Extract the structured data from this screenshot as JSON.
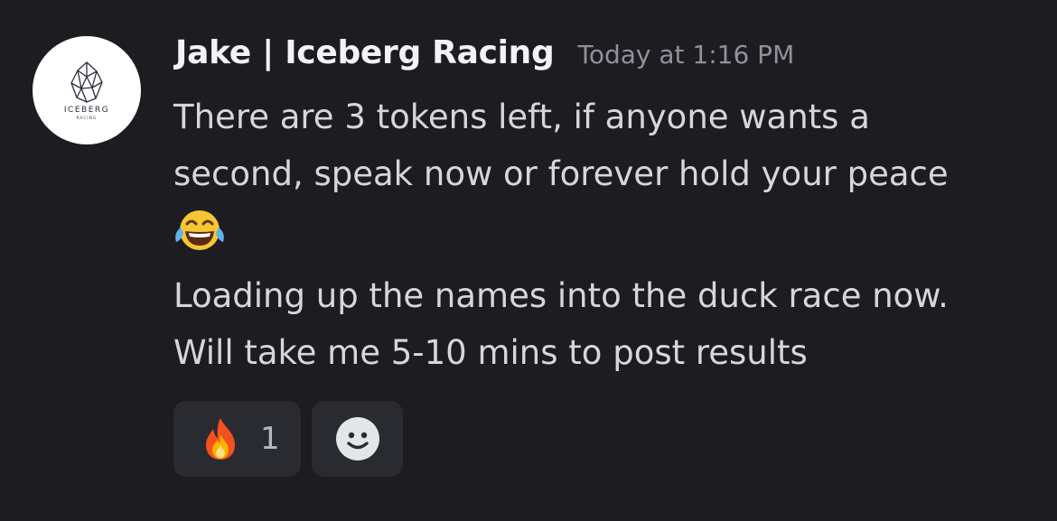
{
  "message": {
    "avatar": {
      "icon": "iceberg-logo-icon",
      "logo_text": "ICEBERG",
      "logo_subtext": "RACING"
    },
    "author": "Jake | Iceberg Racing",
    "timestamp": "Today at 1:16 PM",
    "paragraph1": "There are 3 tokens left, if anyone wants a\nsecond, speak now or forever hold your peace",
    "emoji": "face-with-tears-of-joy-icon",
    "paragraph2": "Loading up the names into the duck race now.\nWill take me 5-10 mins to post results"
  },
  "reactions": [
    {
      "icon": "fire-icon",
      "count": "1"
    },
    {
      "icon": "add-reaction-smiley-icon"
    }
  ],
  "colors": {
    "background": "#1c1c21",
    "username": "#f2f3f5",
    "timestamp": "#8f929b",
    "text": "#d6d7db",
    "reaction_bg": "#2a2b31"
  }
}
